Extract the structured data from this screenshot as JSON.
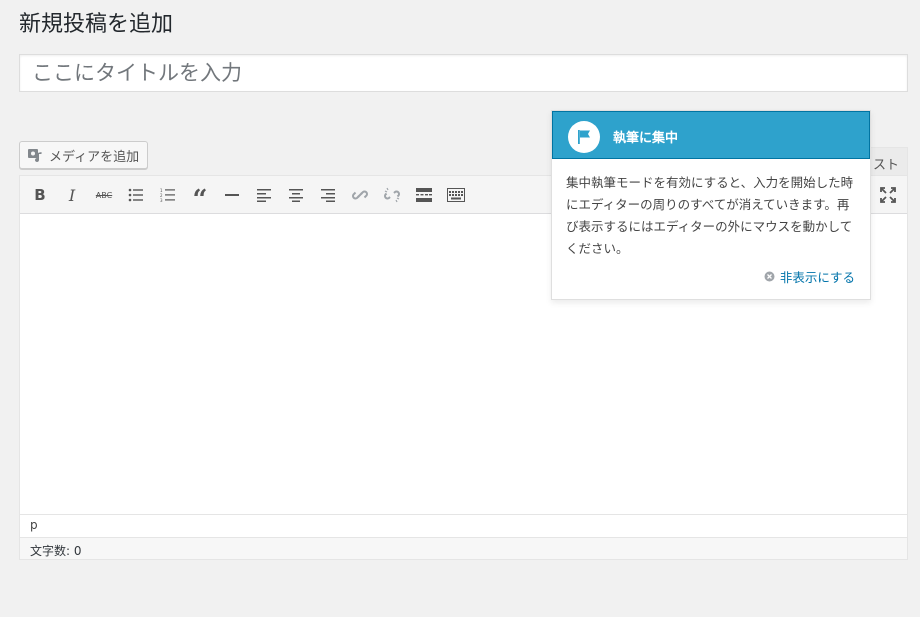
{
  "page": {
    "title": "新規投稿を追加"
  },
  "title_field": {
    "placeholder": "ここにタイトルを入力",
    "value": ""
  },
  "media_button": {
    "label": "メディアを追加",
    "icon": "media-icon"
  },
  "editor_tabs": {
    "text_tab_label": "スト"
  },
  "toolbar": {
    "buttons": [
      "bold",
      "italic",
      "strikethrough",
      "bulleted-list",
      "numbered-list",
      "blockquote",
      "horizontal-line",
      "align-left",
      "align-center",
      "align-right",
      "insert-link",
      "remove-link",
      "read-more",
      "toolbar-toggle",
      "distraction-free"
    ],
    "bold_label": "B",
    "italic_label": "I",
    "strike_label": "ABC",
    "quote_label": "“"
  },
  "editor": {
    "path": "p",
    "word_count": "文字数: 0"
  },
  "pointer": {
    "title": "執筆に集中",
    "body": "集中執筆モードを有効にすると、入力を開始した時にエディターの周りのすべてが消えていきます。再び表示するにはエディターの外にマウスを動かしてください。",
    "dismiss_label": "非表示にする",
    "accent_color": "#2ea2cc"
  }
}
